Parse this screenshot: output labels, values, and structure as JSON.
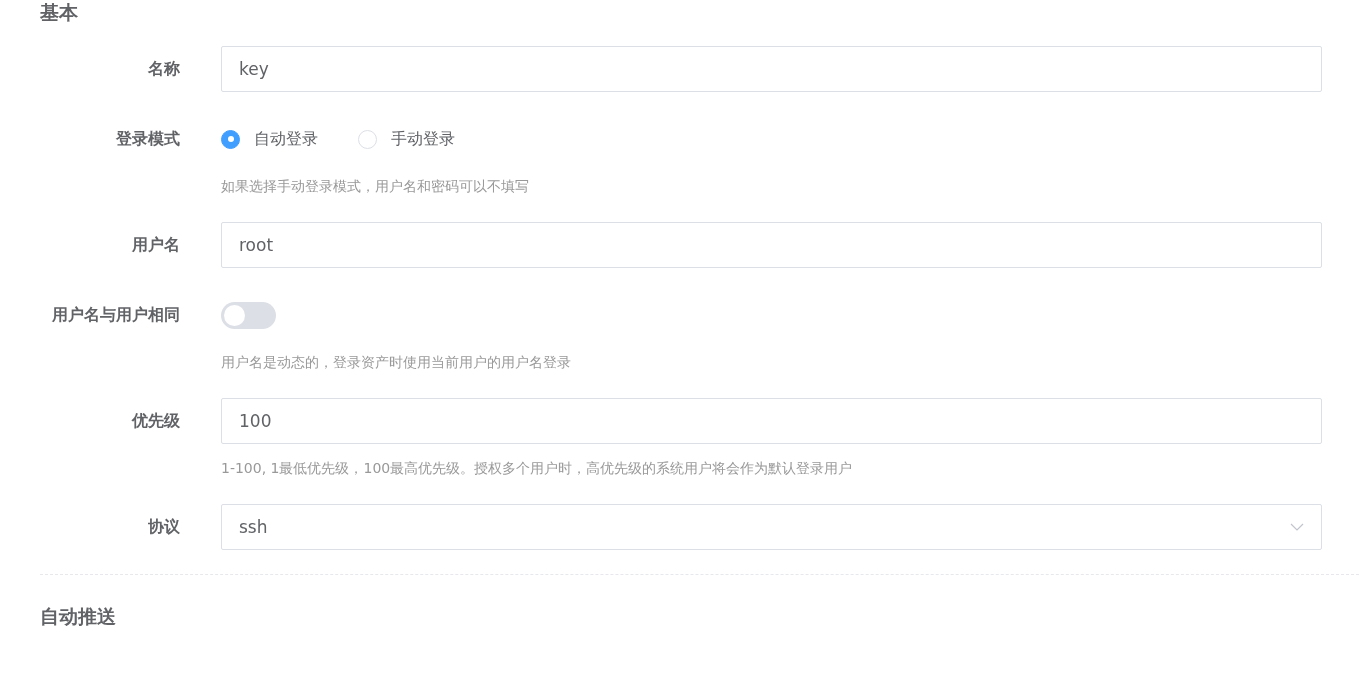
{
  "sections": [
    {
      "title": "基本",
      "fields": [
        {
          "kind": "input",
          "label": "名称",
          "value": "key"
        },
        {
          "kind": "radio",
          "label": "登录模式",
          "options": [
            {
              "label": "自动登录",
              "selected": true
            },
            {
              "label": "手动登录",
              "selected": false
            }
          ],
          "hint": "如果选择手动登录模式，用户名和密码可以不填写"
        },
        {
          "kind": "input",
          "label": "用户名",
          "value": "root"
        },
        {
          "kind": "switch",
          "label": "用户名与用户相同",
          "on": false,
          "hint": "用户名是动态的，登录资产时使用当前用户的用户名登录"
        },
        {
          "kind": "input",
          "label": "优先级",
          "value": "100",
          "hint": "1-100, 1最低优先级，100最高优先级。授权多个用户时，高优先级的系统用户将会作为默认登录用户"
        },
        {
          "kind": "select",
          "label": "协议",
          "value": "ssh"
        }
      ]
    },
    {
      "title": "自动推送"
    }
  ]
}
